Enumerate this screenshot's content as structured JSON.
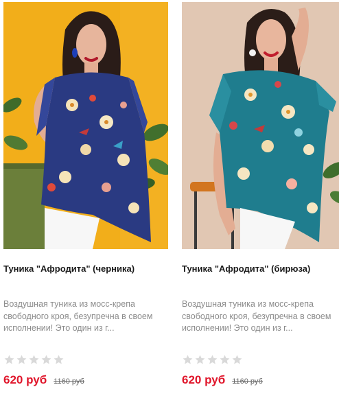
{
  "products": [
    {
      "title": "Туника \"Афродита\" (черника)",
      "description": "Воздушная туника из мосс-крепа свободного кроя, безупречна в своем исполнении! Это один из г...",
      "rating": 0,
      "rating_max": 5,
      "price": "620 руб",
      "old_price": "1160 руб",
      "image": "woman in navy floral tunic on yellow background"
    },
    {
      "title": "Туника \"Афродита\" (бирюза)",
      "description": "Воздушная туника из мосс-крепа свободного кроя, безупречна в своем исполнении! Это один из г...",
      "rating": 0,
      "rating_max": 5,
      "price": "620 руб",
      "old_price": "1160 руб",
      "image": "woman in turquoise floral tunic on beige background"
    }
  ],
  "colors": {
    "price": "#e0162b",
    "title": "#1a1a1a",
    "description": "#8c8c8c",
    "star_empty": "#d9d9d9"
  }
}
